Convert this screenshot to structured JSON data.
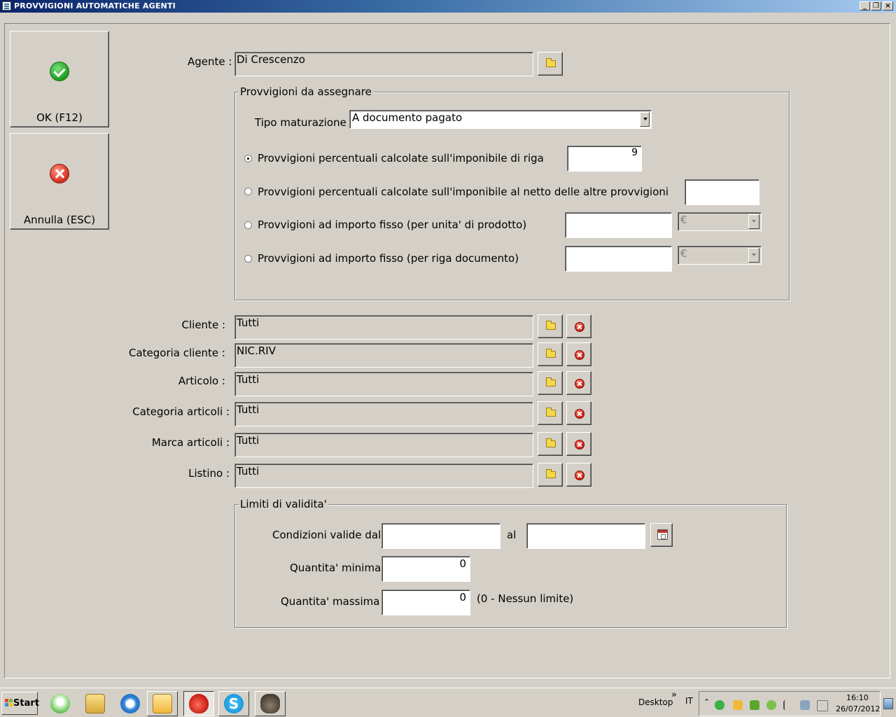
{
  "window": {
    "title": "PROVVIGIONI AUTOMATICHE AGENTI"
  },
  "actions": {
    "ok_label": "OK (F12)",
    "cancel_label": "Annulla (ESC)"
  },
  "agente": {
    "label": "Agente :",
    "value": "Di Crescenzo"
  },
  "provvigioni": {
    "group_title": "Provvigioni da assegnare",
    "tipo_label": "Tipo maturazione :",
    "tipo_value": "A documento pagato",
    "options": [
      {
        "label": "Provvigioni percentuali calcolate sull'imponibile di riga",
        "value": "9",
        "checked": true
      },
      {
        "label": "Provvigioni percentuali calcolate sull'imponibile al netto delle altre provvigioni",
        "value": "",
        "checked": false
      },
      {
        "label": "Provvigioni ad importo fisso (per unita' di prodotto)",
        "value": "",
        "currency": "€",
        "checked": false
      },
      {
        "label": "Provvigioni ad importo fisso (per riga documento)",
        "value": "",
        "currency": "€",
        "checked": false
      }
    ]
  },
  "filters": [
    {
      "label": "Cliente :",
      "value": "Tutti"
    },
    {
      "label": "Categoria cliente :",
      "value": "NIC.RIV"
    },
    {
      "label": "Articolo :",
      "value": "Tutti"
    },
    {
      "label": "Categoria articoli :",
      "value": "Tutti"
    },
    {
      "label": "Marca articoli :",
      "value": "Tutti"
    },
    {
      "label": "Listino :",
      "value": "Tutti"
    }
  ],
  "limiti": {
    "group_title": "Limiti di validita'",
    "dal_label": "Condizioni valide dal",
    "al_label": "al",
    "dal_value": "",
    "al_value": "",
    "qmin_label": "Quantita' minima",
    "qmin_value": "0",
    "qmax_label": "Quantita' massima",
    "qmax_value": "0",
    "qmax_hint": "(0 - Nessun limite)"
  },
  "taskbar": {
    "start_label": "Start",
    "desktop_label": "Desktop",
    "chevron": "»",
    "lang": "IT",
    "time": "16:10",
    "date": "26/07/2012",
    "apps": [
      "orb-icon",
      "explorer-folder-icon",
      "internet-explorer-icon",
      "outlook-icon",
      "strawberry-app-icon",
      "skype-icon",
      "gimp-icon"
    ]
  }
}
